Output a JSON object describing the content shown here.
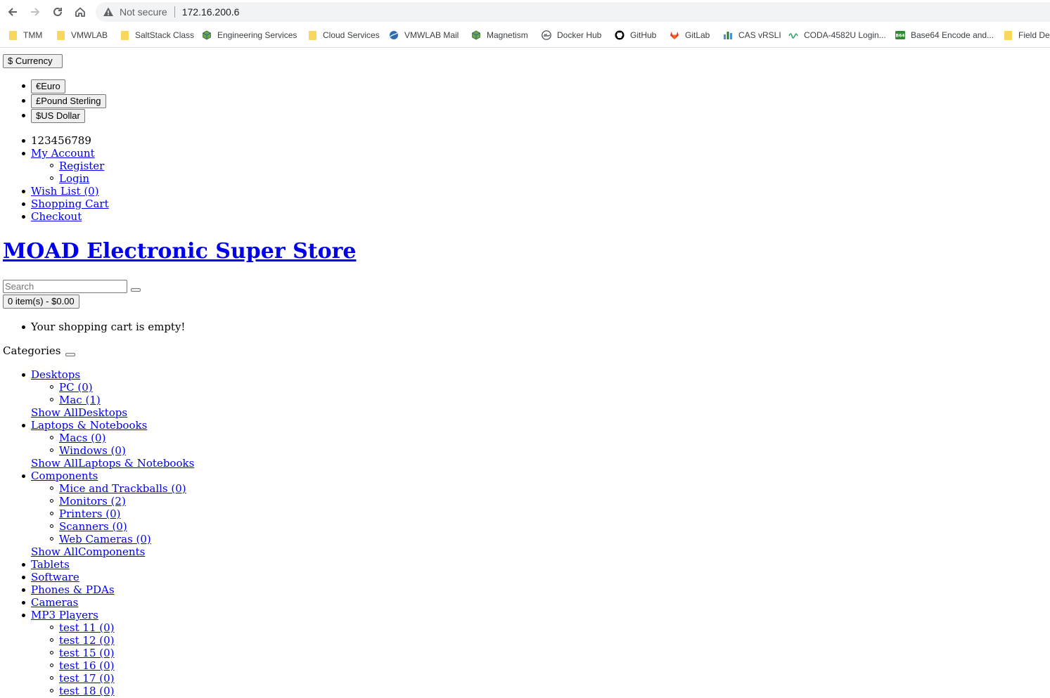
{
  "browser": {
    "security_label": "Not secure",
    "url": "172.16.200.6",
    "bookmarks": [
      {
        "label": "TMM",
        "icon": "folder-icon"
      },
      {
        "label": "VMWLAB",
        "icon": "folder-icon"
      },
      {
        "label": "SaltStack Class",
        "icon": "folder-icon"
      },
      {
        "label": "Engineering Services",
        "icon": "cube-icon"
      },
      {
        "label": "Cloud Services",
        "icon": "folder-icon"
      },
      {
        "label": "VMWLAB Mail",
        "icon": "globe-icon"
      },
      {
        "label": "Magnetism",
        "icon": "cube-icon"
      },
      {
        "label": "Docker Hub",
        "icon": "docker-icon"
      },
      {
        "label": "GitHub",
        "icon": "github-icon"
      },
      {
        "label": "GitLab",
        "icon": "gitlab-icon"
      },
      {
        "label": "CAS vRSLI",
        "icon": "chart-icon"
      },
      {
        "label": "CODA-4582U Login...",
        "icon": "wave-icon"
      },
      {
        "label": "Base64 Encode and...",
        "icon": "b64-icon"
      },
      {
        "label": "Field De",
        "icon": "folder-icon"
      }
    ]
  },
  "currency": {
    "button_label": "$ Currency",
    "options": [
      "€Euro",
      "£Pound Sterling",
      "$US Dollar"
    ]
  },
  "top_links": {
    "phone": "123456789",
    "my_account": "My Account",
    "register": "Register",
    "login": "Login",
    "wish_list": "Wish List (0)",
    "shopping_cart": "Shopping Cart",
    "checkout": "Checkout"
  },
  "store": {
    "name": "MOAD Electronic Super Store"
  },
  "search": {
    "placeholder": "Search"
  },
  "cart": {
    "button_label": "0 item(s) - $0.00",
    "empty_message": "Your shopping cart is empty!"
  },
  "categories": {
    "label": "Categories",
    "desktops": {
      "label": "Desktops",
      "children": [
        "PC (0)",
        "Mac (1)"
      ],
      "show_all": "Show AllDesktops"
    },
    "laptops": {
      "label": "Laptops & Notebooks",
      "children": [
        "Macs (0)",
        "Windows (0)"
      ],
      "show_all": "Show AllLaptops & Notebooks"
    },
    "components": {
      "label": "Components",
      "children": [
        "Mice and Trackballs (0)",
        "Monitors (2)",
        "Printers (0)",
        "Scanners (0)",
        "Web Cameras (0)"
      ],
      "show_all": "Show AllComponents"
    },
    "tablets": "Tablets",
    "software": "Software",
    "phones": "Phones & PDAs",
    "cameras": "Cameras",
    "mp3": {
      "label": "MP3 Players",
      "children": [
        "test 11 (0)",
        "test 12 (0)",
        "test 15 (0)",
        "test 16 (0)",
        "test 17 (0)",
        "test 18 (0)"
      ]
    }
  }
}
